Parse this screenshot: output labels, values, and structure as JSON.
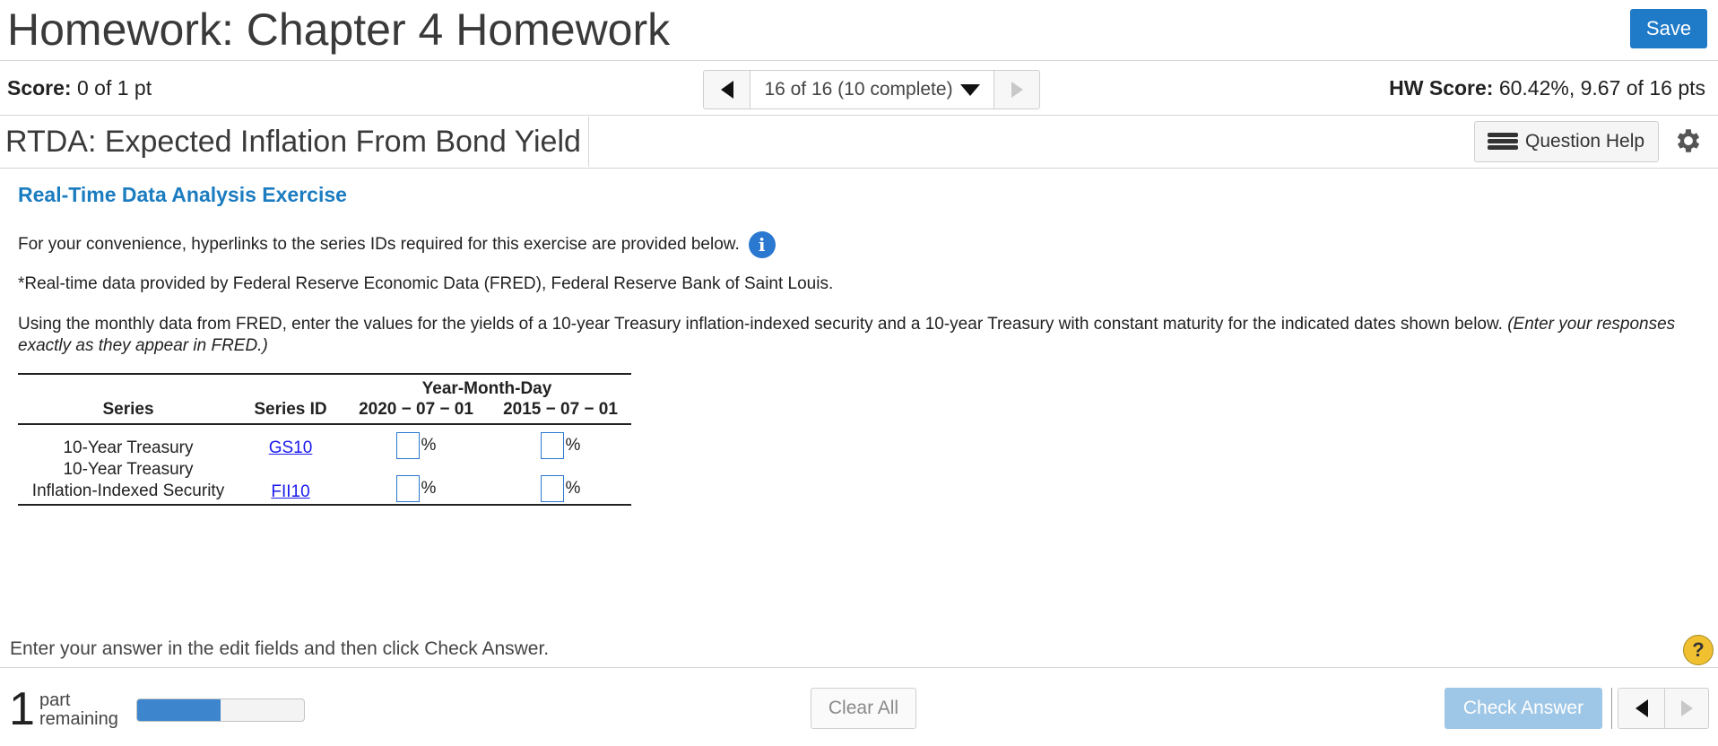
{
  "header": {
    "title": "Homework: Chapter 4 Homework",
    "save_label": "Save"
  },
  "score_bar": {
    "score_label": "Score:",
    "score_value": "0 of 1 pt",
    "nav_label": "16 of 16 (10 complete)",
    "hw_score_label": "HW Score:",
    "hw_score_value": "60.42%, 9.67 of 16 pts"
  },
  "question_bar": {
    "title": "RTDA: Expected Inflation From Bond Yield",
    "help_label": "Question Help"
  },
  "content": {
    "section_title": "Real-Time Data Analysis Exercise",
    "p1": "For your convenience, hyperlinks to the series IDs required for this exercise are provided below.",
    "p2": "*Real-time data provided by Federal Reserve Economic Data (FRED), Federal Reserve Bank of Saint Louis.",
    "p3": "Using the monthly data from FRED, enter the values for the yields of a 10-year Treasury inflation-indexed security and a 10-year Treasury with constant maturity for the indicated dates shown below.",
    "p3_italic": "(Enter your responses exactly as they appear in FRED.)"
  },
  "table": {
    "group_header": "Year-Month-Day",
    "col_series": "Series",
    "col_series_id": "Series ID",
    "col_date1": "2020 − 07 − 01",
    "col_date2": "2015 − 07 − 01",
    "rows": [
      {
        "series_line1": "10-Year Treasury",
        "series_line2": "",
        "series_id": "GS10",
        "value1": "",
        "value2": "",
        "unit": "%"
      },
      {
        "series_line1": "10-Year Treasury",
        "series_line2": "Inflation-Indexed Security",
        "series_id": "FII10",
        "value1": "",
        "value2": "",
        "unit": "%"
      }
    ]
  },
  "footer": {
    "instruction": "Enter your answer in the edit fields and then click Check Answer.",
    "parts_count": "1",
    "parts_label_1": "part",
    "parts_label_2": "remaining",
    "progress_fraction": 0.5,
    "clear_label": "Clear All",
    "check_label": "Check Answer",
    "help_symbol": "?"
  },
  "colors": {
    "accent": "#1f7ac8",
    "section_title": "#1b7cc0",
    "link": "#1a1aee",
    "check_disabled": "#9ec6e6",
    "progress": "#3d85cc"
  }
}
